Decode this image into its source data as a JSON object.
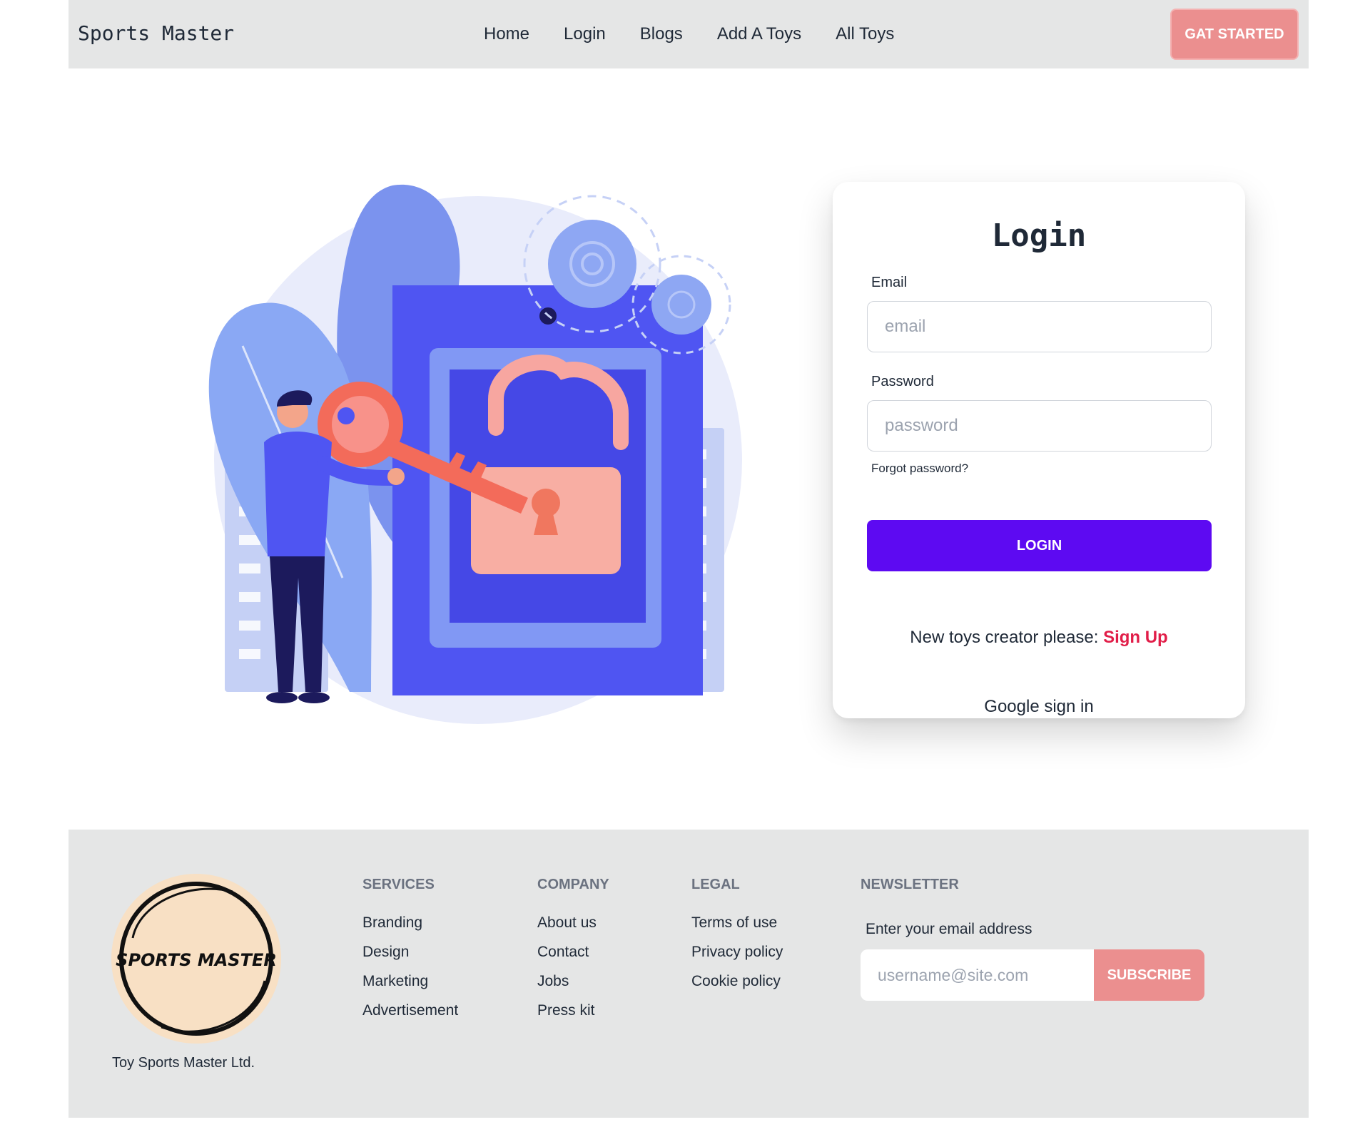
{
  "navbar": {
    "brand": "Sports Master",
    "links": [
      "Home",
      "Login",
      "Blogs",
      "Add A Toys",
      "All Toys"
    ],
    "cta_label": "GAT STARTED"
  },
  "login": {
    "title": "Login",
    "email_label": "Email",
    "email_placeholder": "email",
    "password_label": "Password",
    "password_placeholder": "password",
    "forgot": "Forgot password?",
    "button": "LOGIN",
    "signup_prompt": "New toys creator please:",
    "signup_link": "Sign Up",
    "google": "Google sign in"
  },
  "footer": {
    "logo_text": "SPORTS MASTER",
    "company_name": "Toy Sports Master Ltd.",
    "services": {
      "title": "SERVICES",
      "items": [
        "Branding",
        "Design",
        "Marketing",
        "Advertisement"
      ]
    },
    "company": {
      "title": "COMPANY",
      "items": [
        "About us",
        "Contact",
        "Jobs",
        "Press kit"
      ]
    },
    "legal": {
      "title": "LEGAL",
      "items": [
        "Terms of use",
        "Privacy policy",
        "Cookie policy"
      ]
    },
    "newsletter": {
      "title": "NEWSLETTER",
      "label": "Enter your email address",
      "placeholder": "username@site.com",
      "button": "SUBSCRIBE"
    }
  },
  "colors": {
    "bar_bg": "#e5e6e6",
    "accent_pink": "#eb8f8f",
    "login_button": "#5d0af2",
    "signup_link": "#e11d48"
  },
  "icons": [
    "lock-illustration",
    "key-icon",
    "gear-icon",
    "sports-master-logo"
  ]
}
